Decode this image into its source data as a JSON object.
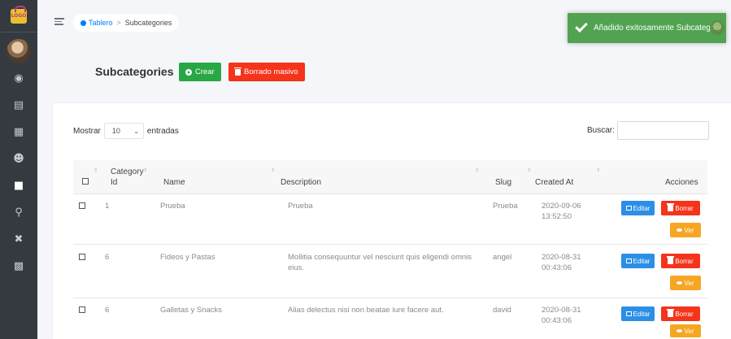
{
  "sidebar": {
    "logo_text": "LOGO",
    "icons": [
      "dashboard-icon",
      "store-icon",
      "building-icon",
      "users-icon",
      "tag-icon",
      "map-marker-icon",
      "tools-icon",
      "trash-icon"
    ]
  },
  "breadcrumb": {
    "home": "Tablero",
    "separator": ">",
    "current": "Subcategories"
  },
  "toast": {
    "message": "Añadido exitosamente Subcategory"
  },
  "page": {
    "title": "Subcategories",
    "create_label": "Crear",
    "mass_delete_label": "Borrado masivo"
  },
  "table_controls": {
    "show_label": "Mostrar",
    "page_size": "10",
    "entries_label": "entradas",
    "search_label": "Buscar:",
    "search_value": ""
  },
  "table": {
    "columns": {
      "category_id": [
        "Category",
        "Id"
      ],
      "name": "Name",
      "description": "Description",
      "slug": "Slug",
      "created_at": "Created At",
      "actions": "Acciones"
    },
    "rows": [
      {
        "category_id": "1",
        "name": "Prueba",
        "description": "Prueba",
        "description2": "",
        "slug": "Prueba",
        "date": "2020-09-06",
        "time": "13:52:50"
      },
      {
        "category_id": "6",
        "name": "Fideos y Pastas",
        "description": "Mollitia consequuntur vel nesciunt quis eligendi omnis",
        "description2": "eius.",
        "slug": "angel",
        "date": "2020-08-31",
        "time": "00:43:06"
      },
      {
        "category_id": "6",
        "name": "Galletas y Snacks",
        "description": "Alias delectus nisi non beatae iure facere aut.",
        "description2": "",
        "slug": "david",
        "date": "2020-08-31",
        "time": "00:43:06"
      }
    ],
    "actions": {
      "edit": "Editar",
      "delete": "Borrar",
      "view": "Ver"
    }
  },
  "colors": {
    "sidebar": "#343a40",
    "success": "#28a745",
    "danger": "#f4341b",
    "info": "#2b8fe6",
    "warning": "#f7a623",
    "toast": "#51a351"
  }
}
